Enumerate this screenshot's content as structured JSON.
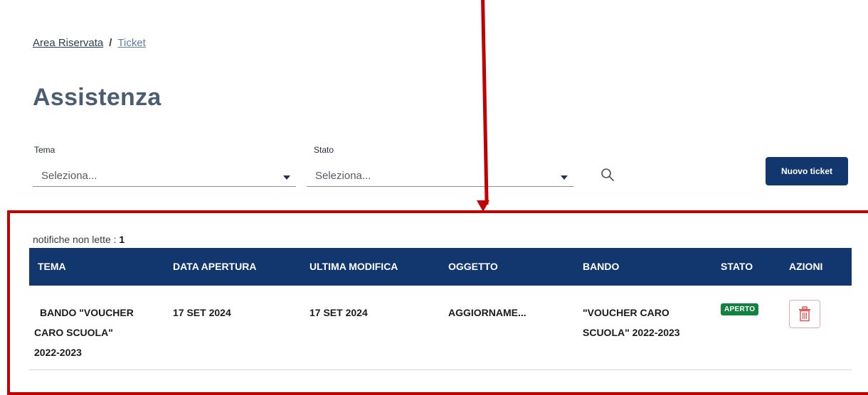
{
  "breadcrumb": {
    "root": "Area Riservata",
    "separator": "/",
    "current": "Ticket"
  },
  "page_title": "Assistenza",
  "filters": {
    "tema": {
      "label": "Tema",
      "value": "Seleziona..."
    },
    "stato": {
      "label": "Stato",
      "value": "Seleziona..."
    }
  },
  "actions": {
    "new_ticket": "Nuovo ticket"
  },
  "unread": {
    "label": "notifiche non lette :",
    "count": "1"
  },
  "table": {
    "headers": [
      "TEMA",
      "DATA APERTURA",
      "ULTIMA MODIFICA",
      "OGGETTO",
      "BANDO",
      "STATO",
      "AZIONI"
    ],
    "rows": [
      {
        "tema_lines": [
          "BANDO \"VOUCHER",
          "CARO SCUOLA\"",
          "2022-2023"
        ],
        "data_apertura": "17 SET 2024",
        "ultima_modifica": "17 SET 2024",
        "oggetto": "AGGIORNAME...",
        "bando_lines": [
          "\"VOUCHER CARO",
          "SCUOLA\" 2022-2023"
        ],
        "stato": "APERTO"
      }
    ]
  },
  "colors": {
    "primary": "#12366e",
    "status_open": "#128141",
    "highlight": "#c00000",
    "danger": "#d9534f"
  },
  "icons": [
    "chevron-down-icon",
    "search-icon",
    "trash-icon"
  ]
}
